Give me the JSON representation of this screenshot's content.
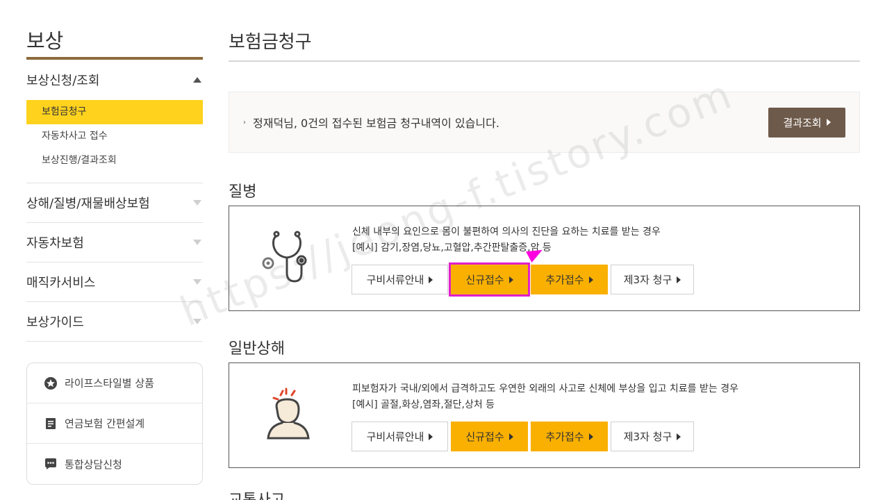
{
  "sidebar": {
    "title": "보상",
    "groups": [
      {
        "label": "보상신청/조회",
        "open": true,
        "items": [
          {
            "label": "보험금청구",
            "active": true
          },
          {
            "label": "자동차사고 접수"
          },
          {
            "label": "보상진행/결과조회"
          }
        ]
      },
      {
        "label": "상해/질병/재물배상보험"
      },
      {
        "label": "자동차보험"
      },
      {
        "label": "매직카서비스"
      },
      {
        "label": "보상가이드"
      }
    ],
    "quick": [
      {
        "label": "라이프스타일별 상품",
        "icon": "star-circle-icon"
      },
      {
        "label": "연금보험 간편설계",
        "icon": "document-icon"
      },
      {
        "label": "통합상담신청",
        "icon": "chat-bubble-icon"
      }
    ]
  },
  "main": {
    "page_title": "보험금청구",
    "notice": {
      "text": "정재덕님, 0건의 접수된 보험금 청구내역이 있습니다.",
      "button": "결과조회"
    },
    "sections": [
      {
        "title": "질병",
        "icon": "stethoscope-icon",
        "line1": "신체 내부의 요인으로 몸이 불편하여 의사의 진단을 요하는 치료를 받는 경우",
        "line2": "[예시] 감기,장염,당뇨,고혈압,추간판탈출증,암 등",
        "buttons": [
          "구비서류안내",
          "신규접수",
          "추가접수",
          "제3자 청구"
        ]
      },
      {
        "title": "일반상해",
        "icon": "injured-person-icon",
        "line1": "피보험자가 국내/외에서 급격하고도 우연한 외래의 사고로 신체에 부상을 입고 치료를 받는 경우",
        "line2": "[예시] 골절,화상,염좌,절단,상처 등",
        "buttons": [
          "구비서류안내",
          "신규접수",
          "추가접수",
          "제3자 청구"
        ]
      }
    ],
    "next_section_title": "교통사고"
  },
  "watermark": "https://jeong-f.tistory.com",
  "colors": {
    "accent_yellow": "#f9b000",
    "active_menu": "#ffd21e",
    "brown_button": "#6e5a4b",
    "highlight": "#e020c8"
  }
}
